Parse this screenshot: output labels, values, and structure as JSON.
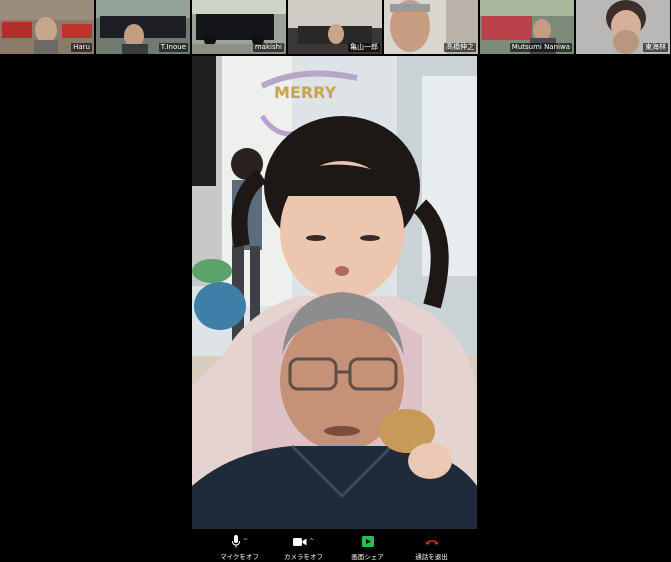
{
  "participants": [
    {
      "name": "Haru"
    },
    {
      "name": "T.Inoue"
    },
    {
      "name": "makishi"
    },
    {
      "name": "亀山一郎"
    },
    {
      "name": "髙橋伸之"
    },
    {
      "name": "Mutsumi Naniwa"
    },
    {
      "name": "東海林"
    }
  ],
  "main_banner_text": "MERRY",
  "toolbar": {
    "mute_label": "マイクをオフ",
    "video_label": "カメラをオフ",
    "share_label": "画面シェア",
    "leave_label": "通話を退出"
  },
  "colors": {
    "active_speaker": "#2dbd4f",
    "share_icon": "#2dbd4f",
    "leave_icon": "#e0262b"
  }
}
